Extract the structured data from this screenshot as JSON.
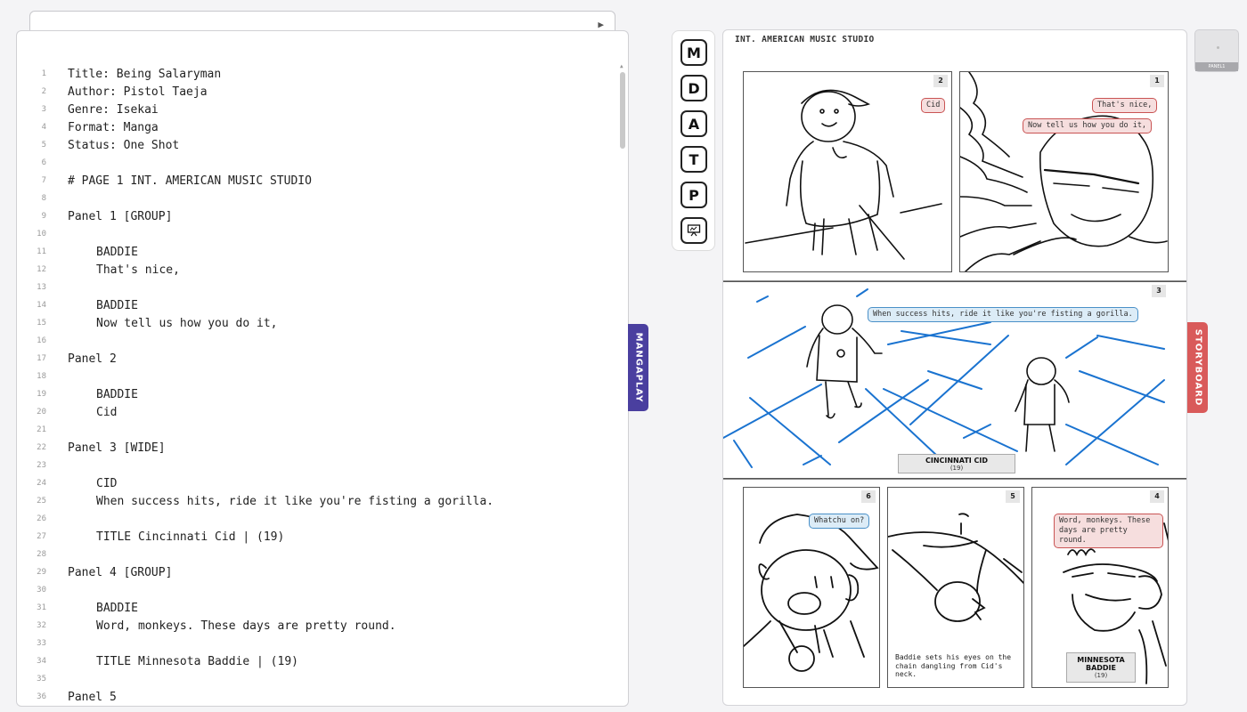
{
  "command_bar": {
    "run_label": "▶"
  },
  "editor": {
    "lines": [
      {
        "n": "1",
        "text": "Title: Being Salaryman",
        "indent": false
      },
      {
        "n": "2",
        "text": "Author: Pistol Taeja",
        "indent": false
      },
      {
        "n": "3",
        "text": "Genre: Isekai",
        "indent": false
      },
      {
        "n": "4",
        "text": "Format: Manga",
        "indent": false
      },
      {
        "n": "5",
        "text": "Status: One Shot",
        "indent": false
      },
      {
        "n": "6",
        "text": "",
        "indent": false
      },
      {
        "n": "7",
        "text": "# PAGE 1 INT. AMERICAN MUSIC STUDIO",
        "indent": false
      },
      {
        "n": "8",
        "text": "",
        "indent": false
      },
      {
        "n": "9",
        "text": "Panel 1 [GROUP]",
        "indent": false
      },
      {
        "n": "10",
        "text": "",
        "indent": false
      },
      {
        "n": "11",
        "text": "BADDIE",
        "indent": true
      },
      {
        "n": "12",
        "text": "That's nice,",
        "indent": true
      },
      {
        "n": "13",
        "text": "",
        "indent": false
      },
      {
        "n": "14",
        "text": "BADDIE",
        "indent": true
      },
      {
        "n": "15",
        "text": "Now tell us how you do it,",
        "indent": true
      },
      {
        "n": "16",
        "text": "",
        "indent": false
      },
      {
        "n": "17",
        "text": "Panel 2",
        "indent": false
      },
      {
        "n": "18",
        "text": "",
        "indent": false
      },
      {
        "n": "19",
        "text": "BADDIE",
        "indent": true
      },
      {
        "n": "20",
        "text": "Cid",
        "indent": true
      },
      {
        "n": "21",
        "text": "",
        "indent": false
      },
      {
        "n": "22",
        "text": "Panel 3 [WIDE]",
        "indent": false
      },
      {
        "n": "23",
        "text": "",
        "indent": false
      },
      {
        "n": "24",
        "text": "CID",
        "indent": true
      },
      {
        "n": "25",
        "text": "When success hits, ride it like you're fisting a gorilla.",
        "indent": true
      },
      {
        "n": "26",
        "text": "",
        "indent": false
      },
      {
        "n": "27",
        "text": "TITLE Cincinnati Cid | (19)",
        "indent": true
      },
      {
        "n": "28",
        "text": "",
        "indent": false
      },
      {
        "n": "29",
        "text": "Panel 4 [GROUP]",
        "indent": false
      },
      {
        "n": "30",
        "text": "",
        "indent": false
      },
      {
        "n": "31",
        "text": "BADDIE",
        "indent": true
      },
      {
        "n": "32",
        "text": "Word, monkeys. These days are pretty round.",
        "indent": true
      },
      {
        "n": "33",
        "text": "",
        "indent": false
      },
      {
        "n": "34",
        "text": "TITLE Minnesota Baddie | (19)",
        "indent": true
      },
      {
        "n": "35",
        "text": "",
        "indent": false
      },
      {
        "n": "36",
        "text": "Panel 5",
        "indent": false
      }
    ]
  },
  "tabs": {
    "mangaplay": "MANGAPLAY",
    "storyboard": "STORYBOARD"
  },
  "tools": [
    "M",
    "D",
    "A",
    "T",
    "P"
  ],
  "mini_preview": {
    "label": "PANEL1"
  },
  "storyboard": {
    "heading": "INT. AMERICAN MUSIC STUDIO",
    "panels": {
      "p1": {
        "num": "1",
        "bubble1": "That's nice,",
        "bubble2": "Now tell us how you do it,"
      },
      "p2": {
        "num": "2",
        "bubble": "Cid"
      },
      "p3": {
        "num": "3",
        "bubble": "When success hits, ride it like you're fisting a gorilla.",
        "caption_name": "CINCINNATI CID",
        "caption_sub": "(19)"
      },
      "p4": {
        "num": "4",
        "bubble": "Word, monkeys. These days are pretty round.",
        "caption_name": "MINNESOTA BADDIE",
        "caption_sub": "(19)"
      },
      "p5": {
        "num": "5",
        "narration": "Baddie sets his eyes on the chain dangling from Cid's neck."
      },
      "p6": {
        "num": "6",
        "bubble": "Whatchu on?"
      }
    }
  },
  "colors": {
    "mangaplay_tab": "#4a3f9f",
    "storyboard_tab": "#d95a5a",
    "bubble_red": "#c95454",
    "bubble_blue": "#4a90c8",
    "grid_blue": "#1a73d0"
  }
}
